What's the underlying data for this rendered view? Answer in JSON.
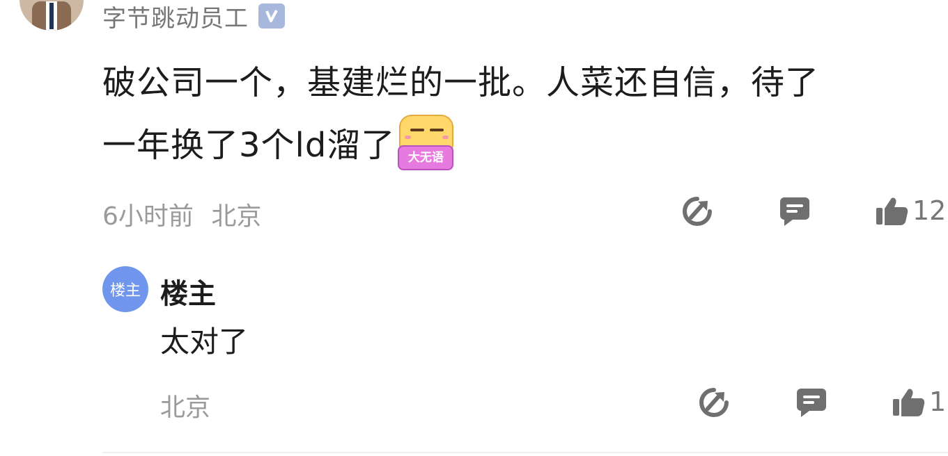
{
  "comment": {
    "author": "字节跳动员工",
    "verified_badge": "V",
    "text_line1": "破公司一个，基建烂的一批。人菜还自信，待了",
    "text_line2": "一年换了3个ld溜了",
    "sticker_label": "大无语",
    "time": "6小时前",
    "location": "北京",
    "like_count": "12"
  },
  "reply": {
    "avatar_label": "楼主",
    "author": "楼主",
    "text": "太对了",
    "location": "北京",
    "like_count": "1"
  },
  "icons": {
    "share": "share-icon",
    "reply": "comment-icon",
    "like": "thumbs-up-icon"
  },
  "colors": {
    "icon": "#6f6f6f",
    "meta_text": "#9a9a9a",
    "reply_avatar": "#6f96ec",
    "verified_badge": "#a7b8dc"
  }
}
